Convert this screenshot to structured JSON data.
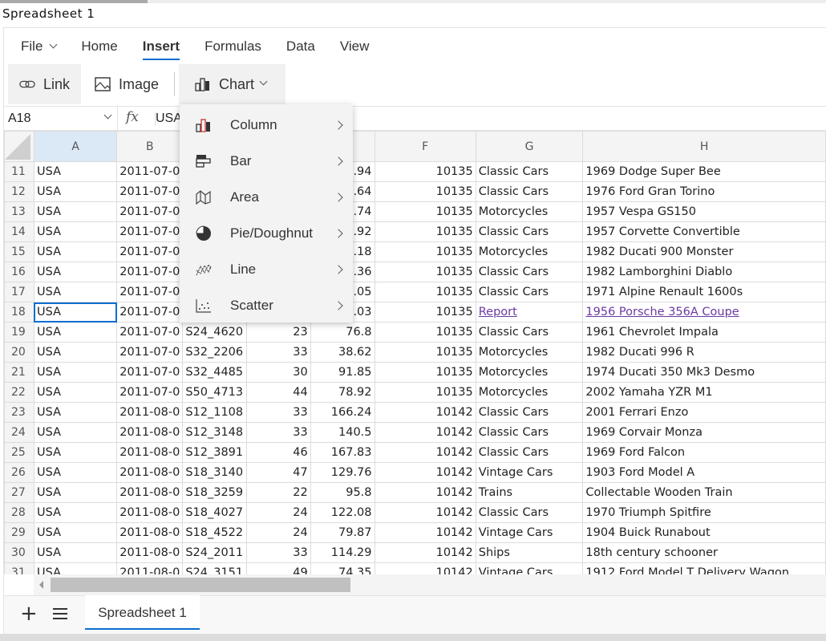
{
  "window": {
    "title": "Spreadsheet 1"
  },
  "ribbon": {
    "tabs": [
      {
        "label": "File"
      },
      {
        "label": "Home"
      },
      {
        "label": "Insert"
      },
      {
        "label": "Formulas"
      },
      {
        "label": "Data"
      },
      {
        "label": "View"
      }
    ],
    "active_tab": "Insert",
    "buttons": {
      "link": "Link",
      "image": "Image",
      "chart": "Chart"
    }
  },
  "formula_bar": {
    "name_box": "A18",
    "fx": "fx",
    "value": "USA"
  },
  "chart_menu": {
    "items": [
      {
        "label": "Column",
        "icon": "column-chart-icon"
      },
      {
        "label": "Bar",
        "icon": "bar-chart-icon"
      },
      {
        "label": "Area",
        "icon": "area-chart-icon"
      },
      {
        "label": "Pie/Doughnut",
        "icon": "pie-chart-icon"
      },
      {
        "label": "Line",
        "icon": "line-chart-icon"
      },
      {
        "label": "Scatter",
        "icon": "scatter-chart-icon"
      }
    ]
  },
  "grid": {
    "columns": [
      "A",
      "B",
      "C",
      "D",
      "E",
      "F",
      "G",
      "H"
    ],
    "selected_cell": "A18",
    "rows": [
      {
        "n": "11",
        "c": [
          "USA",
          "2011-07-0",
          "",
          "",
          ".94",
          "10135",
          "Classic Cars",
          "1969 Dodge Super Bee"
        ]
      },
      {
        "n": "12",
        "c": [
          "USA",
          "2011-07-0",
          "",
          "",
          ".64",
          "10135",
          "Classic Cars",
          "1976 Ford Gran Torino"
        ]
      },
      {
        "n": "13",
        "c": [
          "USA",
          "2011-07-0",
          "",
          "",
          ".74",
          "10135",
          "Motorcycles",
          "1957 Vespa GS150"
        ]
      },
      {
        "n": "14",
        "c": [
          "USA",
          "2011-07-0",
          "",
          "",
          ".92",
          "10135",
          "Classic Cars",
          "1957 Corvette Convertible"
        ]
      },
      {
        "n": "15",
        "c": [
          "USA",
          "2011-07-0",
          "",
          "",
          ".18",
          "10135",
          "Motorcycles",
          "1982 Ducati 900 Monster"
        ]
      },
      {
        "n": "16",
        "c": [
          "USA",
          "2011-07-0",
          "",
          "",
          ".36",
          "10135",
          "Classic Cars",
          "1982 Lamborghini Diablo"
        ]
      },
      {
        "n": "17",
        "c": [
          "USA",
          "2011-07-0",
          "",
          "",
          ".05",
          "10135",
          "Classic Cars",
          "1971 Alpine Renault 1600s"
        ]
      },
      {
        "n": "18",
        "c": [
          "USA",
          "2011-07-0",
          "",
          "",
          ".03",
          "10135",
          "Report",
          "1956 Porsche 356A Coupe"
        ],
        "links": [
          6,
          7
        ]
      },
      {
        "n": "19",
        "c": [
          "USA",
          "2011-07-0",
          "S24_4620",
          "23",
          "76.8",
          "10135",
          "Classic Cars",
          "1961 Chevrolet Impala"
        ]
      },
      {
        "n": "20",
        "c": [
          "USA",
          "2011-07-0",
          "S32_2206",
          "33",
          "38.62",
          "10135",
          "Motorcycles",
          "1982 Ducati 996 R"
        ]
      },
      {
        "n": "21",
        "c": [
          "USA",
          "2011-07-0",
          "S32_4485",
          "30",
          "91.85",
          "10135",
          "Motorcycles",
          "1974 Ducati 350 Mk3 Desmo"
        ]
      },
      {
        "n": "22",
        "c": [
          "USA",
          "2011-07-0",
          "S50_4713",
          "44",
          "78.92",
          "10135",
          "Motorcycles",
          "2002 Yamaha YZR M1"
        ]
      },
      {
        "n": "23",
        "c": [
          "USA",
          "2011-08-0",
          "S12_1108",
          "33",
          "166.24",
          "10142",
          "Classic Cars",
          "2001 Ferrari Enzo"
        ]
      },
      {
        "n": "24",
        "c": [
          "USA",
          "2011-08-0",
          "S12_3148",
          "33",
          "140.5",
          "10142",
          "Classic Cars",
          "1969 Corvair Monza"
        ]
      },
      {
        "n": "25",
        "c": [
          "USA",
          "2011-08-0",
          "S12_3891",
          "46",
          "167.83",
          "10142",
          "Classic Cars",
          "1969 Ford Falcon"
        ]
      },
      {
        "n": "26",
        "c": [
          "USA",
          "2011-08-0",
          "S18_3140",
          "47",
          "129.76",
          "10142",
          "Vintage Cars",
          "1903 Ford Model A"
        ]
      },
      {
        "n": "27",
        "c": [
          "USA",
          "2011-08-0",
          "S18_3259",
          "22",
          "95.8",
          "10142",
          "Trains",
          "Collectable Wooden Train"
        ]
      },
      {
        "n": "28",
        "c": [
          "USA",
          "2011-08-0",
          "S18_4027",
          "24",
          "122.08",
          "10142",
          "Classic Cars",
          "1970 Triumph Spitfire"
        ]
      },
      {
        "n": "29",
        "c": [
          "USA",
          "2011-08-0",
          "S18_4522",
          "24",
          "79.87",
          "10142",
          "Vintage Cars",
          "1904 Buick Runabout"
        ]
      },
      {
        "n": "30",
        "c": [
          "USA",
          "2011-08-0",
          "S24_2011",
          "33",
          "114.29",
          "10142",
          "Ships",
          "18th century schooner"
        ]
      },
      {
        "n": "31",
        "c": [
          "USA",
          "2011-08-0",
          "S24_3151",
          "49",
          "74.35",
          "10142",
          "Vintage Cars",
          "1912 Ford Model T Delivery Wagon"
        ]
      }
    ]
  },
  "sheets": {
    "tabs": [
      "Spreadsheet 1"
    ],
    "active": "Spreadsheet 1"
  },
  "colors": {
    "accent": "#0a6ed1",
    "link": "#6a3aa2",
    "selected_header": "#dbe8f6"
  }
}
